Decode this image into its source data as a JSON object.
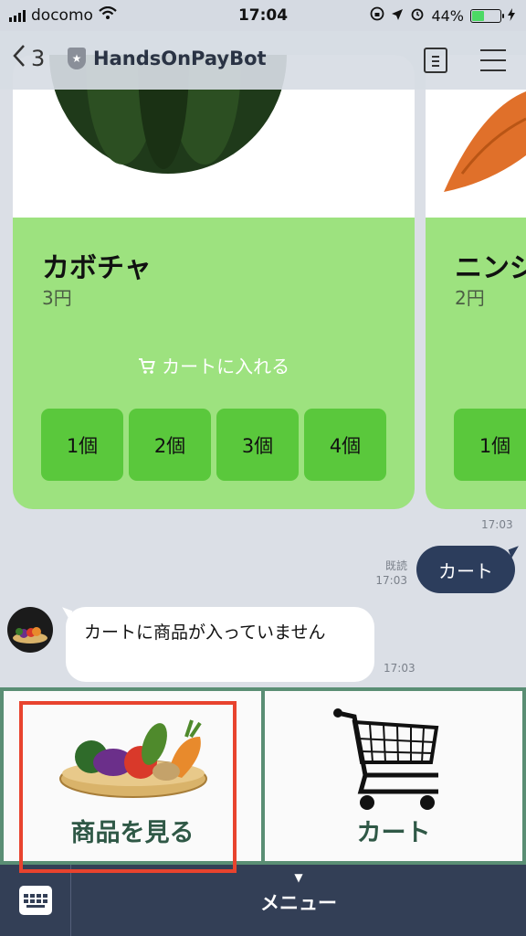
{
  "status_bar": {
    "carrier": "docomo",
    "time": "17:04",
    "battery": "44%"
  },
  "header": {
    "back_count": "3",
    "title": "HandsOnPayBot"
  },
  "products": [
    {
      "name": "カボチャ",
      "price": "3円",
      "add_to_cart": "カートに入れる",
      "quantities": [
        "1個",
        "2個",
        "3個",
        "4個"
      ]
    },
    {
      "name": "ニンジ",
      "price": "2円",
      "quantities": [
        "1個"
      ]
    }
  ],
  "messages": {
    "carousel_time": "17:03",
    "user_message": "カート",
    "read_label": "既読",
    "user_time": "17:03",
    "bot_message": "カートに商品が入っていません",
    "bot_time": "17:03"
  },
  "rich_menu": {
    "view_products": "商品を見る",
    "cart": "カート"
  },
  "bottom_bar": {
    "menu_label": "メニュー"
  },
  "colors": {
    "card_green": "#9de27f",
    "qty_green": "#5ac83c",
    "accent_navy": "#2c3d5c",
    "menu_border": "#5a8e74",
    "highlight_red": "#e8432e"
  }
}
